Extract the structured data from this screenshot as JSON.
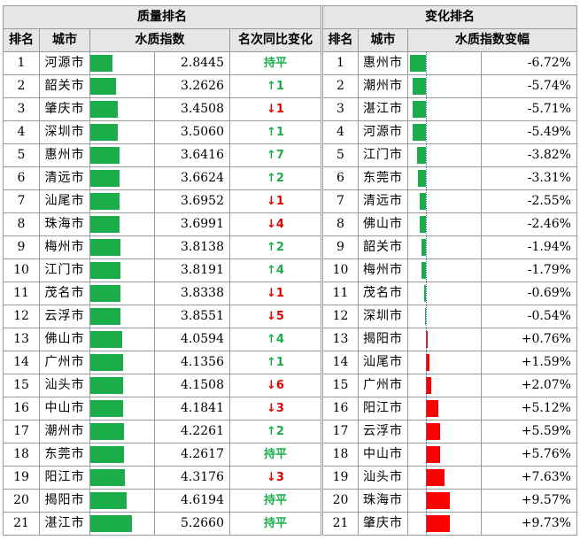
{
  "left": {
    "title": "质量排名",
    "headers": {
      "rank": "排名",
      "city": "城市",
      "index": "水质指数",
      "change": "名次同比变化"
    },
    "rows": [
      {
        "rank": "1",
        "city": "河源市",
        "value": "2.8445",
        "num": 2.8445,
        "change": "持平",
        "dir": "flat"
      },
      {
        "rank": "2",
        "city": "韶关市",
        "value": "3.2626",
        "num": 3.2626,
        "change": "↑1",
        "dir": "up"
      },
      {
        "rank": "3",
        "city": "肇庆市",
        "value": "3.4508",
        "num": 3.4508,
        "change": "↓1",
        "dir": "down"
      },
      {
        "rank": "4",
        "city": "深圳市",
        "value": "3.5060",
        "num": 3.506,
        "change": "↑1",
        "dir": "up"
      },
      {
        "rank": "5",
        "city": "惠州市",
        "value": "3.6416",
        "num": 3.6416,
        "change": "↑7",
        "dir": "up"
      },
      {
        "rank": "6",
        "city": "清远市",
        "value": "3.6624",
        "num": 3.6624,
        "change": "↑2",
        "dir": "up"
      },
      {
        "rank": "7",
        "city": "汕尾市",
        "value": "3.6952",
        "num": 3.6952,
        "change": "↓1",
        "dir": "down"
      },
      {
        "rank": "8",
        "city": "珠海市",
        "value": "3.6991",
        "num": 3.6991,
        "change": "↓4",
        "dir": "down"
      },
      {
        "rank": "9",
        "city": "梅州市",
        "value": "3.8138",
        "num": 3.8138,
        "change": "↑2",
        "dir": "up"
      },
      {
        "rank": "10",
        "city": "江门市",
        "value": "3.8191",
        "num": 3.8191,
        "change": "↑4",
        "dir": "up"
      },
      {
        "rank": "11",
        "city": "茂名市",
        "value": "3.8338",
        "num": 3.8338,
        "change": "↓1",
        "dir": "down"
      },
      {
        "rank": "12",
        "city": "云浮市",
        "value": "3.8551",
        "num": 3.8551,
        "change": "↓5",
        "dir": "down"
      },
      {
        "rank": "13",
        "city": "佛山市",
        "value": "4.0594",
        "num": 4.0594,
        "change": "↑4",
        "dir": "up"
      },
      {
        "rank": "14",
        "city": "广州市",
        "value": "4.1356",
        "num": 4.1356,
        "change": "↑1",
        "dir": "up"
      },
      {
        "rank": "15",
        "city": "汕头市",
        "value": "4.1508",
        "num": 4.1508,
        "change": "↓6",
        "dir": "down"
      },
      {
        "rank": "16",
        "city": "中山市",
        "value": "4.1841",
        "num": 4.1841,
        "change": "↓3",
        "dir": "down"
      },
      {
        "rank": "17",
        "city": "潮州市",
        "value": "4.2261",
        "num": 4.2261,
        "change": "↑2",
        "dir": "up"
      },
      {
        "rank": "18",
        "city": "东莞市",
        "value": "4.2617",
        "num": 4.2617,
        "change": "持平",
        "dir": "flat"
      },
      {
        "rank": "19",
        "city": "阳江市",
        "value": "4.3176",
        "num": 4.3176,
        "change": "↓3",
        "dir": "down"
      },
      {
        "rank": "20",
        "city": "揭阳市",
        "value": "4.6194",
        "num": 4.6194,
        "change": "持平",
        "dir": "flat"
      },
      {
        "rank": "21",
        "city": "湛江市",
        "value": "5.2660",
        "num": 5.266,
        "change": "持平",
        "dir": "flat"
      }
    ]
  },
  "right": {
    "title": "变化排名",
    "headers": {
      "rank": "排名",
      "city": "城市",
      "change": "水质指数变幅"
    },
    "rows": [
      {
        "rank": "1",
        "city": "惠州市",
        "value": "-6.72%",
        "num": -6.72
      },
      {
        "rank": "2",
        "city": "潮州市",
        "value": "-5.74%",
        "num": -5.74
      },
      {
        "rank": "3",
        "city": "湛江市",
        "value": "-5.71%",
        "num": -5.71
      },
      {
        "rank": "4",
        "city": "河源市",
        "value": "-5.49%",
        "num": -5.49
      },
      {
        "rank": "5",
        "city": "江门市",
        "value": "-3.82%",
        "num": -3.82
      },
      {
        "rank": "6",
        "city": "东莞市",
        "value": "-3.31%",
        "num": -3.31
      },
      {
        "rank": "7",
        "city": "清远市",
        "value": "-2.55%",
        "num": -2.55
      },
      {
        "rank": "8",
        "city": "佛山市",
        "value": "-2.46%",
        "num": -2.46
      },
      {
        "rank": "9",
        "city": "韶关市",
        "value": "-1.94%",
        "num": -1.94
      },
      {
        "rank": "10",
        "city": "梅州市",
        "value": "-1.79%",
        "num": -1.79
      },
      {
        "rank": "11",
        "city": "茂名市",
        "value": "-0.69%",
        "num": -0.69
      },
      {
        "rank": "12",
        "city": "深圳市",
        "value": "-0.54%",
        "num": -0.54
      },
      {
        "rank": "13",
        "city": "揭阳市",
        "value": "+0.76%",
        "num": 0.76
      },
      {
        "rank": "14",
        "city": "汕尾市",
        "value": "+1.59%",
        "num": 1.59
      },
      {
        "rank": "15",
        "city": "广州市",
        "value": "+2.07%",
        "num": 2.07
      },
      {
        "rank": "16",
        "city": "阳江市",
        "value": "+5.12%",
        "num": 5.12
      },
      {
        "rank": "17",
        "city": "云浮市",
        "value": "+5.59%",
        "num": 5.59
      },
      {
        "rank": "18",
        "city": "中山市",
        "value": "+5.76%",
        "num": 5.76
      },
      {
        "rank": "19",
        "city": "汕头市",
        "value": "+7.63%",
        "num": 7.63
      },
      {
        "rank": "20",
        "city": "珠海市",
        "value": "+9.57%",
        "num": 9.57
      },
      {
        "rank": "21",
        "city": "肇庆市",
        "value": "+9.73%",
        "num": 9.73
      }
    ]
  },
  "colors": {
    "green": "#1aad4a",
    "red": "#ff0000",
    "up": "#1aad4a",
    "down": "#e00000"
  }
}
